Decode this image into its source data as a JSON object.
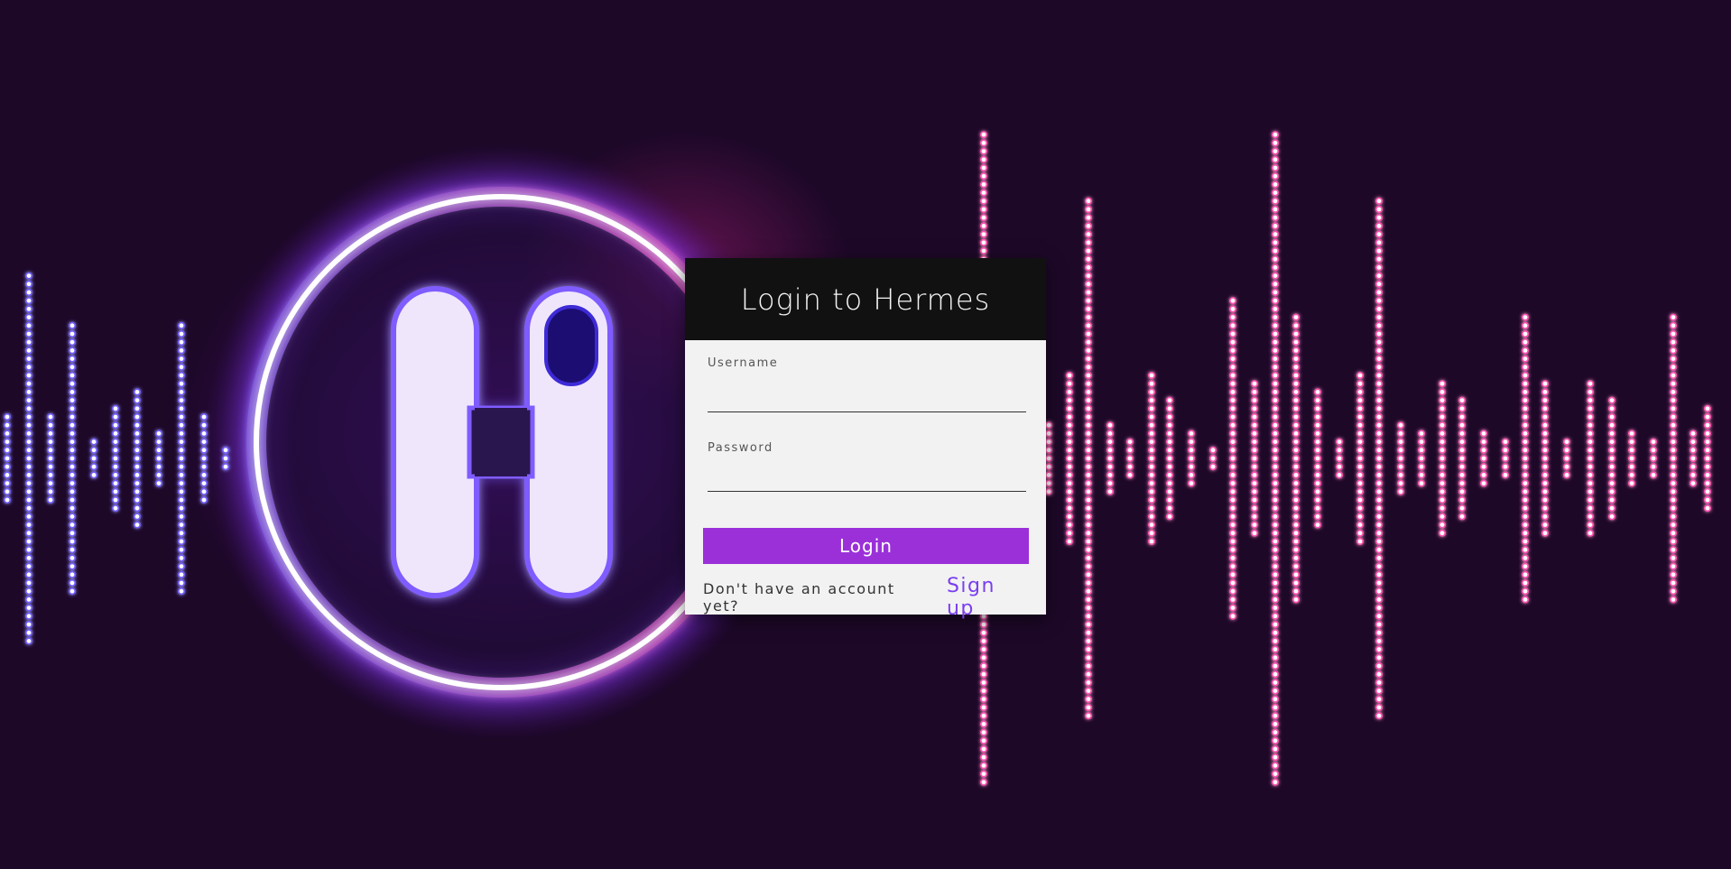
{
  "login": {
    "title": "Login to Hermes",
    "username_label": "Username",
    "username_value": "",
    "password_label": "Password",
    "password_value": "",
    "submit_label": "Login",
    "signup_prompt": "Don't have an account yet?",
    "signup_link": "Sign up"
  },
  "background": {
    "logo_icon": "hermes-h-neon-logo-icon",
    "waveform_icon": "sound-waveform-icon"
  },
  "colors": {
    "background": "#1d0828",
    "header": "#111111",
    "card": "#f2f2f2",
    "accent_button": "#9b30d9",
    "link": "#7a3ef0",
    "wave_left": "#6f5cff",
    "wave_right": "#ff4fb0"
  }
}
